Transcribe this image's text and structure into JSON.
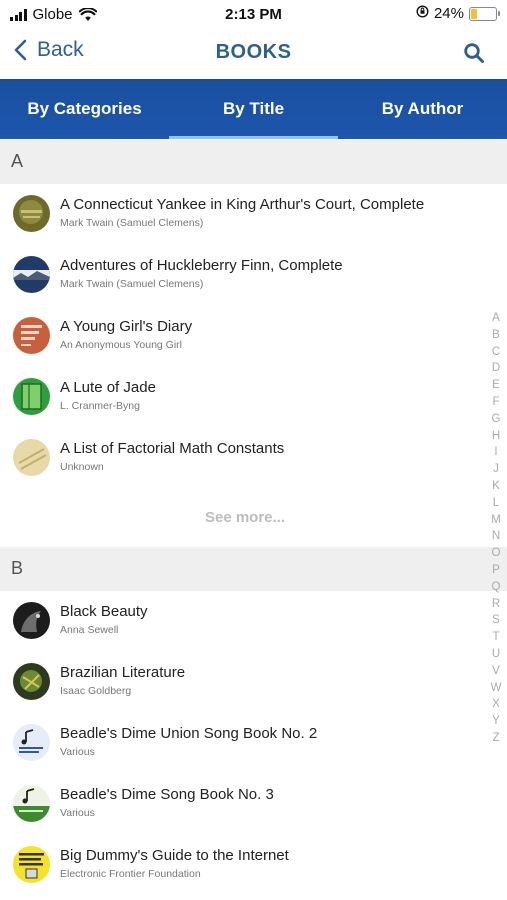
{
  "status_bar": {
    "carrier": "Globe",
    "time": "2:13 PM",
    "battery_percent": "24%",
    "battery_level": 0.24
  },
  "nav": {
    "back_label": "Back",
    "title": "BOOKS",
    "search_icon": "search-icon"
  },
  "tabs": [
    {
      "label": "By Categories",
      "active": false
    },
    {
      "label": "By Title",
      "active": true
    },
    {
      "label": "By Author",
      "active": false
    }
  ],
  "sections": [
    {
      "letter": "A",
      "books": [
        {
          "title": "A Connecticut Yankee in King Arthur's Court, Complete",
          "author": "Mark Twain (Samuel Clemens)"
        },
        {
          "title": "Adventures of Huckleberry Finn, Complete",
          "author": "Mark Twain (Samuel Clemens)"
        },
        {
          "title": "A Young Girl's Diary",
          "author": "An Anonymous Young Girl"
        },
        {
          "title": "A Lute of Jade",
          "author": "L. Cranmer-Byng"
        },
        {
          "title": "A List of Factorial Math Constants",
          "author": "Unknown"
        }
      ],
      "see_more": "See more..."
    },
    {
      "letter": "B",
      "books": [
        {
          "title": "Black Beauty",
          "author": "Anna Sewell"
        },
        {
          "title": "Brazilian Literature",
          "author": "Isaac Goldberg"
        },
        {
          "title": "Beadle's Dime Union Song Book No. 2",
          "author": "Various"
        },
        {
          "title": "Beadle's Dime Song Book No. 3",
          "author": "Various"
        },
        {
          "title": "Big Dummy's Guide to the Internet",
          "author": "Electronic Frontier Foundation"
        }
      ]
    }
  ],
  "index_letters": [
    "A",
    "B",
    "C",
    "D",
    "E",
    "F",
    "G",
    "H",
    "I",
    "J",
    "K",
    "L",
    "M",
    "N",
    "O",
    "P",
    "Q",
    "R",
    "S",
    "T",
    "U",
    "V",
    "W",
    "X",
    "Y",
    "Z"
  ],
  "colors": {
    "accent": "#2e5f8e",
    "tab_bar": "#1d56ac",
    "tab_indicator": "#8ec7f0",
    "section_bg": "#efefef",
    "battery": "#f2c230"
  }
}
